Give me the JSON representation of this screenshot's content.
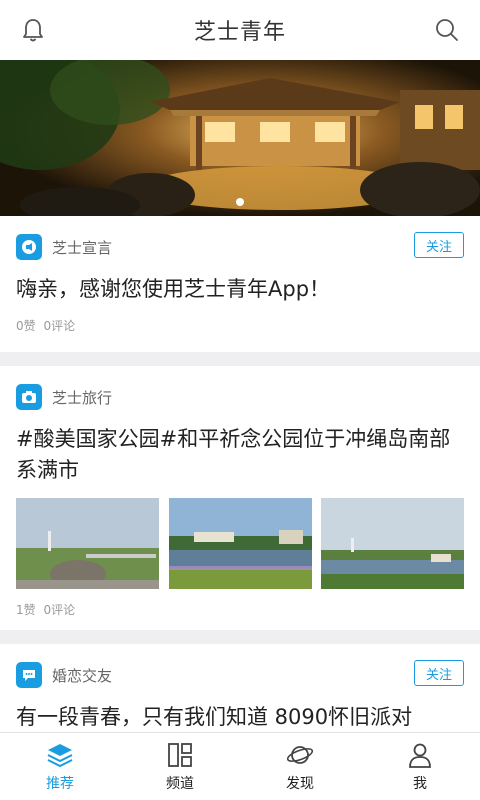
{
  "header": {
    "title": "芝士青年",
    "bell_icon": "bell-icon",
    "search_icon": "search-icon"
  },
  "banner": {
    "slide_count": 1,
    "active_slide": 1
  },
  "colors": {
    "accent": "#1a9de0",
    "separator": "#efeff1",
    "meta_text": "#999999"
  },
  "feed": {
    "cards": [
      {
        "source_name": "芝士宣言",
        "source_icon": "megaphone-icon",
        "follow_label": "关注",
        "headline": "嗨亲，感谢您使用芝士青年App！",
        "likes": "0赞",
        "comments": "0评论"
      },
      {
        "source_name": "芝士旅行",
        "source_icon": "camera-icon",
        "headline": "#酸美国家公园#和平祈念公园位于冲绳岛南部系满市",
        "likes": "1赞",
        "comments": "0评论"
      },
      {
        "source_name": "婚恋交友",
        "source_icon": "chat-icon",
        "follow_label": "关注",
        "headline": "有一段青春，只有我们知道 8090怀旧派对"
      }
    ]
  },
  "tabbar": {
    "tabs": [
      {
        "label": "推荐",
        "icon": "layers-icon",
        "active": true
      },
      {
        "label": "频道",
        "icon": "grid-icon",
        "active": false
      },
      {
        "label": "发现",
        "icon": "planet-icon",
        "active": false
      },
      {
        "label": "我",
        "icon": "user-icon",
        "active": false
      }
    ]
  }
}
